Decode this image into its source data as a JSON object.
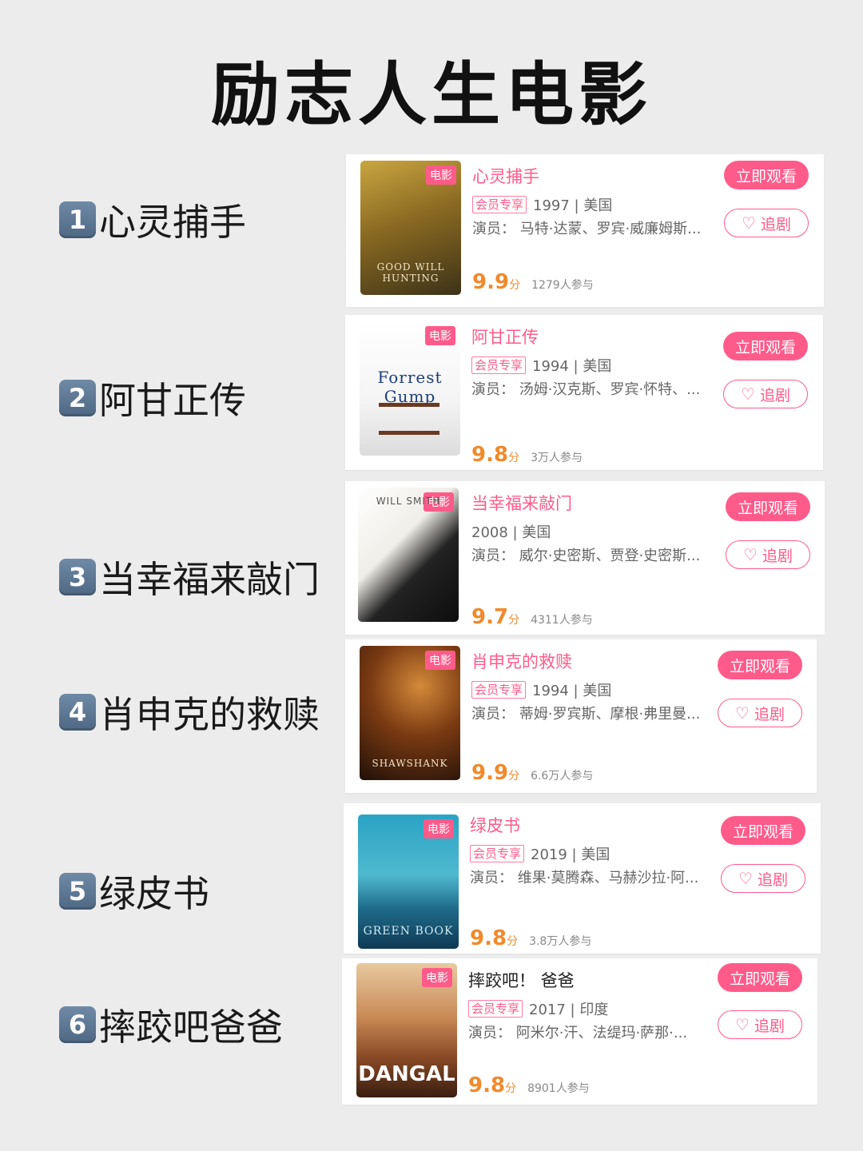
{
  "title": "励志人生电影",
  "labels": {
    "poster_tag": "电影",
    "vip_tag": "会员专享",
    "watch": "立即观看",
    "follow": "追剧",
    "score_unit": "分"
  },
  "colors": {
    "accent": "#ff5b8a",
    "score": "#f08a2c",
    "badge": "#5b7693"
  },
  "icons": {
    "follow": "heart-icon"
  },
  "movies": [
    {
      "num": "1",
      "name": "心灵捕手",
      "meta": "1997 | 美国",
      "vip": true,
      "cast": "演员：  马特·达蒙、罗宾·威廉姆斯...",
      "score": "9.9",
      "participants": "1279人参与",
      "poster_text": "GOOD WILL HUNTING"
    },
    {
      "num": "2",
      "name": "阿甘正传",
      "meta": "1994 | 美国",
      "vip": true,
      "cast": "演员：  汤姆·汉克斯、罗宾·怀特、...",
      "score": "9.8",
      "participants": "3万人参与",
      "poster_text": "Forrest Gump"
    },
    {
      "num": "3",
      "name": "当幸福来敲门",
      "meta": "2008 | 美国",
      "vip": false,
      "cast": "演员：  威尔·史密斯、贾登·史密斯...",
      "score": "9.7",
      "participants": "4311人参与",
      "poster_text": "WILL SMITH"
    },
    {
      "num": "4",
      "name": "肖申克的救赎",
      "meta": "1994 | 美国",
      "vip": true,
      "cast": "演员：  蒂姆·罗宾斯、摩根·弗里曼...",
      "score": "9.9",
      "participants": "6.6万人参与",
      "poster_text": "SHAWSHANK"
    },
    {
      "num": "5",
      "name": "绿皮书",
      "meta": "2019 | 美国",
      "vip": true,
      "cast": "演员：  维果·莫腾森、马赫沙拉·阿...",
      "score": "9.8",
      "participants": "3.8万人参与",
      "poster_text": "GREEN BOOK"
    },
    {
      "num": "6",
      "name": "摔跤吧爸爸",
      "title": "摔跤吧！ 爸爸",
      "meta": "2017 | 印度",
      "vip": true,
      "cast": "演员：  阿米尔·汗、法缇玛·萨那·...",
      "score": "9.8",
      "participants": "8901人参与",
      "poster_text": "DANGAL"
    }
  ]
}
